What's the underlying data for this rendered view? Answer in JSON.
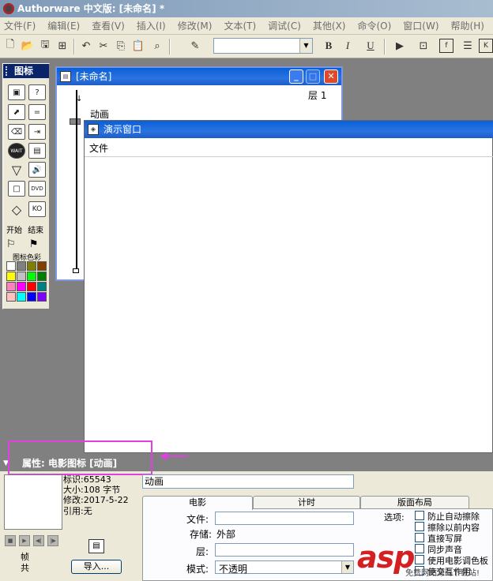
{
  "app": {
    "title": "Authorware 中文版: [未命名] *"
  },
  "menubar": [
    "文件(F)",
    "编辑(E)",
    "查看(V)",
    "插入(I)",
    "修改(M)",
    "文本(T)",
    "调试(C)",
    "其他(X)",
    "命令(O)",
    "窗口(W)",
    "帮助(H)"
  ],
  "toolbar": {
    "bold": "B",
    "italic": "I",
    "underline": "U"
  },
  "palette": {
    "title": "图标",
    "start": "开始",
    "end": "结束",
    "colors_label": "图标色彩",
    "colors": [
      "#ffffff",
      "#808080",
      "#808000",
      "#804000",
      "#ffff00",
      "#c0c0c0",
      "#00ff00",
      "#008000",
      "#ff80c0",
      "#ff00ff",
      "#ff0000",
      "#008080",
      "#ffc0c0",
      "#00ffff",
      "#0000ff",
      "#8000ff"
    ]
  },
  "design_window": {
    "title": "[未命名]",
    "layer": "层 1",
    "icon_label": "动画"
  },
  "presentation_window": {
    "title": "演示窗口",
    "menu": "文件"
  },
  "properties": {
    "header": "属性: 电影图标 [动画]",
    "id": "标识:65543",
    "size": "大小:108 字节",
    "modified": "修改:2017-5-22",
    "refs": "引用:无",
    "frame_label": "帧",
    "total_label": "共",
    "name_value": "动画",
    "tabs": [
      "电影",
      "计时",
      "版面布局"
    ],
    "fields": {
      "file": "文件:",
      "storage": "存储:",
      "storage_value": "外部",
      "layer": "层:",
      "mode": "模式:",
      "mode_value": "不透明"
    },
    "options_label": "选项:",
    "options": [
      "防止自动擦除",
      "擦除以前内容",
      "直接写屏",
      "同步声音",
      "使用电影调色板",
      "使交互作用"
    ],
    "import_button": "导入..."
  },
  "watermark": {
    "logo": "asp",
    "sub": "免费网站源码下载站!"
  }
}
